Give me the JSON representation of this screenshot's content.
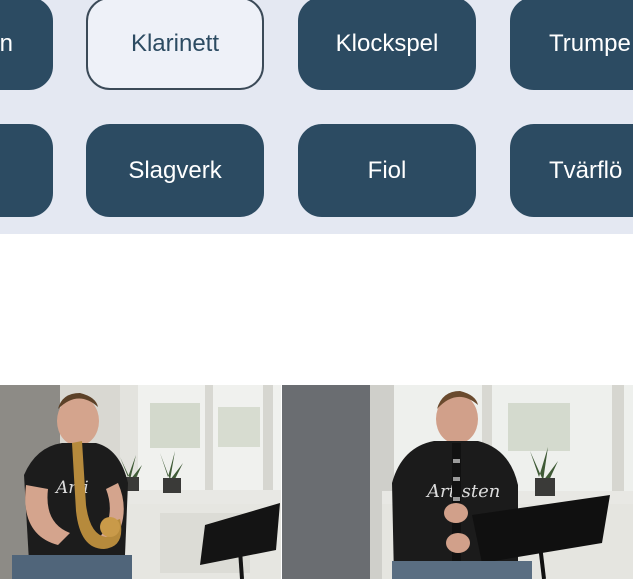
{
  "instruments": {
    "row1": [
      {
        "label": "n",
        "selected": false
      },
      {
        "label": "Klarinett",
        "selected": true
      },
      {
        "label": "Klockspel",
        "selected": false
      },
      {
        "label": "Trumpe",
        "selected": false
      }
    ],
    "row2": [
      {
        "label": "",
        "selected": false
      },
      {
        "label": "Slagverk",
        "selected": false
      },
      {
        "label": "Fiol",
        "selected": false
      },
      {
        "label": "Tvärflö",
        "selected": false
      }
    ]
  },
  "photos": {
    "left": {
      "shirt_text": "Artisten",
      "instrument": "saxophone-icon"
    },
    "right": {
      "shirt_text": "Artisten",
      "instrument": "clarinet-icon"
    }
  },
  "colors": {
    "panel_bg": "#e4e8f2",
    "button_bg": "#2c4b62",
    "button_selected_bg": "#eef1f8"
  }
}
